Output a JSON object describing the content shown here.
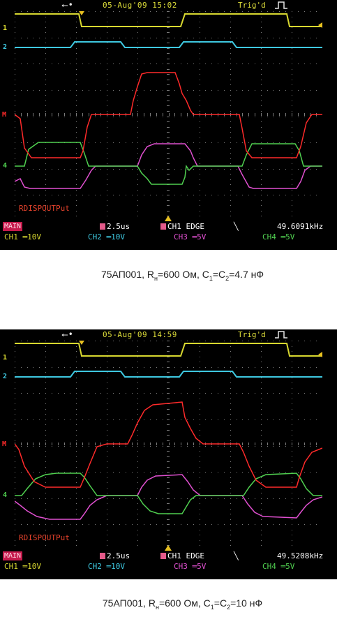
{
  "screens": [
    {
      "usb_icon": "usb-icon",
      "datetime": "05-Aug'09 15:02",
      "trigger_state": "Trig'd",
      "label": "RDISPOUTPut",
      "main_label": "MAIN",
      "timebase": "2.5us",
      "trigger_source": "CH1 EDGE",
      "trigger_slope_icon": "falling-edge-icon",
      "frequency": "49.6091kHz",
      "channels": [
        {
          "name": "CH1",
          "scale": "10V",
          "color": "#d8d830"
        },
        {
          "name": "CH2",
          "scale": "10V",
          "color": "#3ec8e0"
        },
        {
          "name": "CH3",
          "scale": "5V",
          "color": "#e050d0"
        },
        {
          "name": "CH4",
          "scale": "5V",
          "color": "#50d050"
        }
      ],
      "markers": {
        "ch1": "1",
        "ch2": "2",
        "ch3": "M",
        "ch4": "4"
      },
      "caption": {
        "prefix": "75АП001, R",
        "sub1": "н",
        "mid1": "=600 Ом, C",
        "sub2": "1",
        "mid2": "=C",
        "sub3": "2",
        "suffix": "=4.7 нФ"
      }
    },
    {
      "usb_icon": "usb-icon",
      "datetime": "05-Aug'09 14:59",
      "trigger_state": "Trig'd",
      "label": "RDISPOUTPut",
      "main_label": "MAIN",
      "timebase": "2.5us",
      "trigger_source": "CH1 EDGE",
      "trigger_slope_icon": "falling-edge-icon",
      "frequency": "49.5208kHz",
      "channels": [
        {
          "name": "CH1",
          "scale": "10V",
          "color": "#d8d830"
        },
        {
          "name": "CH2",
          "scale": "10V",
          "color": "#3ec8e0"
        },
        {
          "name": "CH3",
          "scale": "5V",
          "color": "#e050d0"
        },
        {
          "name": "CH4",
          "scale": "5V",
          "color": "#50d050"
        }
      ],
      "markers": {
        "ch1": "1",
        "ch2": "2",
        "ch3": "M",
        "ch4": "4"
      },
      "caption": {
        "prefix": "75АП001, R",
        "sub1": "н",
        "mid1": "=600 Ом, C",
        "sub2": "1",
        "mid2": "=C",
        "sub3": "2",
        "suffix": "=10 нФ"
      }
    }
  ],
  "colors": {
    "background": "#000000",
    "grid": "#7a7a7a",
    "ch1": "#d8d830",
    "ch2": "#3ec8e0",
    "ch3": "#e050d0",
    "ch4": "#50d050",
    "math": "#ff2a2a",
    "label": "#e8432d"
  }
}
